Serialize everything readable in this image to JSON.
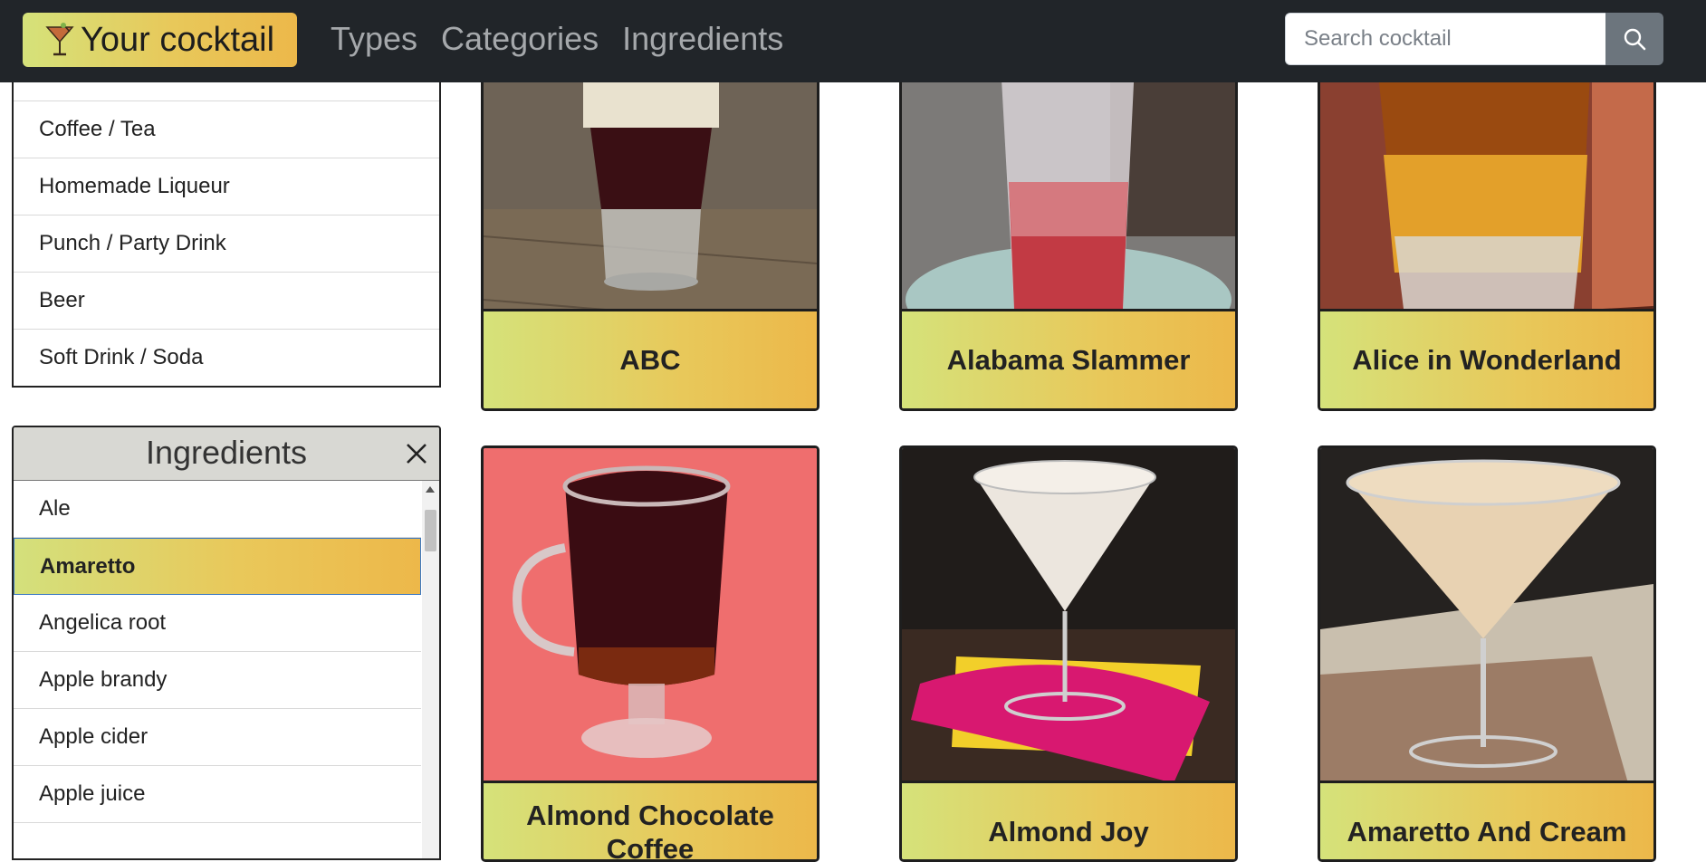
{
  "navbar": {
    "brand": "Your cocktail",
    "links": [
      "Types",
      "Categories",
      "Ingredients"
    ],
    "search_placeholder": "Search cocktail"
  },
  "categories": {
    "items": [
      "Coffee / Tea",
      "Homemade Liqueur",
      "Punch / Party Drink",
      "Beer",
      "Soft Drink / Soda"
    ]
  },
  "ingredients": {
    "title": "Ingredients",
    "items": [
      "Ale",
      "Amaretto",
      "Angelica root",
      "Apple brandy",
      "Apple cider",
      "Apple juice"
    ],
    "selected": "Amaretto"
  },
  "cocktails": [
    {
      "name": "ABC"
    },
    {
      "name": "Alabama Slammer"
    },
    {
      "name": "Alice in Wonderland"
    },
    {
      "name": "Almond Chocolate Coffee"
    },
    {
      "name": "Almond Joy"
    },
    {
      "name": "Amaretto And Cream"
    }
  ],
  "colors": {
    "navbar_bg": "#212529",
    "accent_gradient_start": "#d5e27a",
    "accent_gradient_end": "#ecb84a",
    "card_border": "#1e1e1e"
  },
  "icons": {
    "brand": "cocktail-glass-icon",
    "search": "search-icon",
    "close": "close-icon"
  }
}
